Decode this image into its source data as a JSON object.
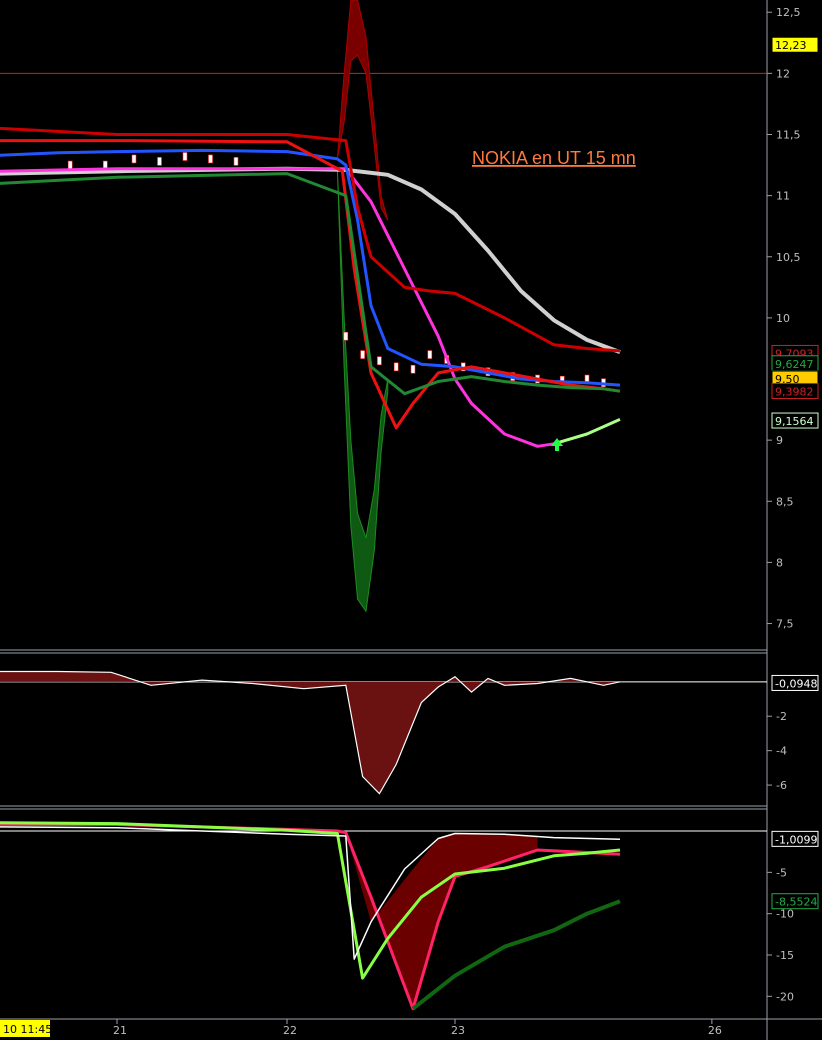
{
  "chart_data": [
    {
      "type": "line",
      "title": "NOKIA en UT 15 mn",
      "ylim": [
        7.3,
        12.6
      ],
      "yticks": [
        {
          "value": 12.5,
          "label": "12,5"
        },
        {
          "value": 12,
          "label": "12"
        },
        {
          "value": 11.5,
          "label": "11,5"
        },
        {
          "value": 11,
          "label": "11"
        },
        {
          "value": 10.5,
          "label": "10,5"
        },
        {
          "value": 10,
          "label": "10"
        },
        {
          "value": 9,
          "label": "9"
        },
        {
          "value": 8.5,
          "label": "8,5"
        },
        {
          "value": 8,
          "label": "8"
        },
        {
          "value": 7.5,
          "label": "7,5"
        }
      ],
      "xlim": [
        20,
        27.2
      ],
      "hline": 12,
      "tags": [
        {
          "value": 12.23,
          "label": "12,23",
          "bg": "#ffff00",
          "fg": "#000000"
        },
        {
          "value": 9.7093,
          "label": "9,7093",
          "bg": "#000000",
          "fg": "#cc2222"
        },
        {
          "value": 9.6247,
          "label": "9,6247",
          "bg": "#000000",
          "fg": "#22aa44"
        },
        {
          "value": 9.5,
          "label": "9,50",
          "bg": "#ffcc00",
          "fg": "#000000"
        },
        {
          "value": 9.3982,
          "label": "9,3982",
          "bg": "#000000",
          "fg": "#cc2222"
        },
        {
          "value": 9.1564,
          "label": "9,1564",
          "bg": "#000000",
          "fg": "#ccffcc"
        }
      ],
      "series": [
        {
          "key": "gray_ma",
          "color": "#d0d0d0",
          "width": 4,
          "x": [
            20,
            21,
            22,
            22.35,
            22.6,
            22.8,
            23.0,
            23.2,
            23.4,
            23.6,
            23.8,
            24.0
          ],
          "y": [
            11.18,
            11.2,
            11.22,
            11.21,
            11.17,
            11.05,
            10.85,
            10.55,
            10.22,
            9.98,
            9.82,
            9.72
          ]
        },
        {
          "key": "magenta",
          "color": "#ff33dd",
          "width": 3,
          "x": [
            20,
            21,
            22.35,
            22.5,
            22.7,
            22.9,
            23.0,
            23.1,
            23.3,
            23.5,
            23.6
          ],
          "y": [
            11.2,
            11.22,
            11.22,
            10.95,
            10.4,
            9.85,
            9.5,
            9.3,
            9.05,
            8.95,
            8.97
          ]
        },
        {
          "key": "light_green",
          "color": "#aaff88",
          "width": 3,
          "x": [
            23.6,
            23.8,
            24.0
          ],
          "y": [
            8.97,
            9.05,
            9.17
          ]
        },
        {
          "key": "blue",
          "color": "#2255ff",
          "width": 3,
          "x": [
            20,
            20.5,
            21,
            21.5,
            22,
            22.3,
            22.35,
            22.42,
            22.5,
            22.6,
            22.8,
            23.0,
            23.2,
            23.4,
            23.6,
            23.8,
            24.0
          ],
          "y": [
            11.33,
            11.35,
            11.36,
            11.37,
            11.36,
            11.3,
            11.25,
            10.8,
            10.1,
            9.75,
            9.62,
            9.6,
            9.55,
            9.5,
            9.48,
            9.47,
            9.45
          ]
        },
        {
          "key": "red_fast",
          "color": "#ee1111",
          "width": 3,
          "x": [
            20,
            21,
            22,
            22.33,
            22.4,
            22.5,
            22.65,
            22.75,
            22.9,
            23.1,
            23.3,
            23.5,
            23.7,
            23.9,
            24.0
          ],
          "y": [
            11.45,
            11.45,
            11.44,
            11.2,
            10.4,
            9.55,
            9.1,
            9.3,
            9.55,
            9.6,
            9.55,
            9.5,
            9.45,
            9.42,
            9.4
          ]
        },
        {
          "key": "red_upper",
          "color": "#cc0000",
          "width": 3,
          "x": [
            20,
            21,
            22,
            22.35,
            22.42,
            22.5,
            22.7,
            22.85,
            23.0,
            23.3,
            23.6,
            23.8,
            24.0
          ],
          "y": [
            11.55,
            11.5,
            11.5,
            11.45,
            10.9,
            10.5,
            10.25,
            10.22,
            10.2,
            10.0,
            9.78,
            9.75,
            9.73
          ]
        },
        {
          "key": "green_lower",
          "color": "#228833",
          "width": 3,
          "x": [
            20,
            21,
            22,
            22.35,
            22.5,
            22.7,
            22.9,
            23.1,
            23.3,
            23.5,
            23.7,
            23.9,
            24.0
          ],
          "y": [
            11.1,
            11.15,
            11.18,
            11.0,
            9.6,
            9.38,
            9.48,
            9.52,
            9.48,
            9.45,
            9.43,
            9.42,
            9.4
          ]
        }
      ]
    },
    {
      "type": "area",
      "ylim": [
        -7.1,
        1.5
      ],
      "yticks": [
        {
          "value": -2,
          "label": "-2"
        },
        {
          "value": -4,
          "label": "-4"
        },
        {
          "value": -6,
          "label": "-6"
        }
      ],
      "zero_line": 0,
      "tags": [
        {
          "value": -0.0948,
          "label": "-0,0948",
          "bg": "#000000",
          "fg": "#ffffff"
        }
      ],
      "x": [
        20,
        20.5,
        20.95,
        21.2,
        21.5,
        21.8,
        22.1,
        22.35,
        22.45,
        22.55,
        22.65,
        22.8,
        22.9,
        23.0,
        23.1,
        23.2,
        23.3,
        23.5,
        23.7,
        23.9,
        24.0
      ],
      "y": [
        0.6,
        0.6,
        0.55,
        -0.2,
        0.1,
        -0.1,
        -0.4,
        -0.2,
        -5.5,
        -6.5,
        -4.8,
        -1.2,
        -0.3,
        0.3,
        -0.6,
        0.2,
        -0.2,
        -0.1,
        0.2,
        -0.2,
        0
      ]
    },
    {
      "type": "line",
      "ylim": [
        -22.5,
        2.3
      ],
      "yticks": [
        {
          "value": -5,
          "label": "-5"
        },
        {
          "value": -10,
          "label": "-10"
        },
        {
          "value": -15,
          "label": "-15"
        },
        {
          "value": -20,
          "label": "-20"
        }
      ],
      "zero_line": 0,
      "tags": [
        {
          "value": -1.0099,
          "label": "-1,0099",
          "bg": "#000000",
          "fg": "#ffffff"
        },
        {
          "value": -8.5524,
          "label": "-8,5524",
          "bg": "#000000",
          "fg": "#22aa44"
        }
      ],
      "series": [
        {
          "key": "pink",
          "color": "#ff2266",
          "width": 3,
          "x": [
            20,
            21,
            22,
            22.3,
            22.35,
            22.5,
            22.75,
            22.9,
            23.0,
            23.2,
            23.5,
            23.8,
            24.0
          ],
          "y": [
            0.8,
            0.8,
            0.2,
            0,
            -0.2,
            -8,
            -21.5,
            -11,
            -5.5,
            -4.3,
            -2.3,
            -2.6,
            -2.8
          ]
        },
        {
          "key": "lime",
          "color": "#88ff44",
          "width": 3,
          "x": [
            20,
            21,
            22,
            22.3,
            22.45,
            22.6,
            22.8,
            23.0,
            23.3,
            23.6,
            23.8,
            24.0
          ],
          "y": [
            1.0,
            0.9,
            0.1,
            -0.3,
            -17.8,
            -13,
            -8,
            -5.2,
            -4.5,
            -3,
            -2.7,
            -2.3
          ]
        },
        {
          "key": "white",
          "color": "#ffffff",
          "width": 1.5,
          "x": [
            20,
            21,
            22,
            22.35,
            22.4,
            22.5,
            22.7,
            22.9,
            23.0,
            23.3,
            23.6,
            24.0
          ],
          "y": [
            0.5,
            0.4,
            -0.4,
            -0.6,
            -15.5,
            -11,
            -4.6,
            -0.9,
            -0.3,
            -0.4,
            -0.8,
            -1.0
          ]
        },
        {
          "key": "dark_green",
          "color": "#116611",
          "width": 4,
          "x": [
            22.75,
            23.0,
            23.3,
            23.6,
            23.8,
            24.0
          ],
          "y": [
            -21.5,
            -17.5,
            -14,
            -12,
            -10,
            -8.5
          ]
        }
      ]
    }
  ],
  "x_axis": {
    "date_badge": "10 11:45",
    "ticks": [
      {
        "value": 21,
        "label": "21"
      },
      {
        "value": 22,
        "label": "22"
      },
      {
        "value": 23,
        "label": "23"
      },
      {
        "value": 26,
        "label": "26"
      }
    ]
  },
  "colors": {
    "background": "#000000",
    "axis_text": "#bfbfbf",
    "separator": "#9aa0aa",
    "title": "#ff7a3c",
    "hline": "#cc2222"
  },
  "icons": {
    "buy_signal": "green-up-arrow-icon"
  }
}
